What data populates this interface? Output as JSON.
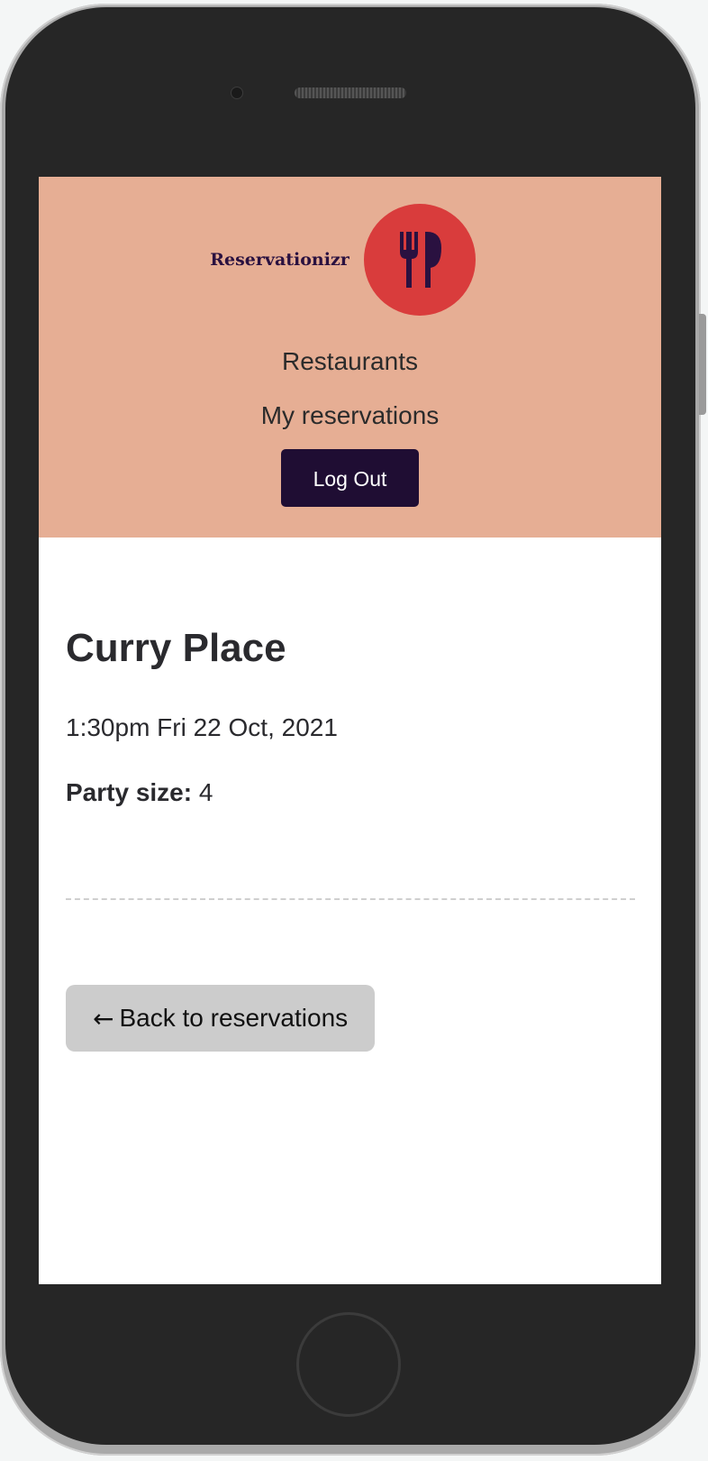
{
  "brand": {
    "name": "Reservationizr",
    "logo_color": "#d93c3c",
    "logo_icon": "fork-knife-icon"
  },
  "nav": {
    "restaurants": "Restaurants",
    "my_reservations": "My reservations",
    "logout": "Log Out"
  },
  "reservation": {
    "restaurant_name": "Curry Place",
    "datetime": "1:30pm Fri 22 Oct, 2021",
    "party_label": "Party size:",
    "party_size": "4"
  },
  "actions": {
    "back_arrow": "←",
    "back_label": "Back to reservations"
  },
  "colors": {
    "header_bg": "#e6ae94",
    "primary_dark": "#1f0d33",
    "back_button_bg": "#cccccc"
  }
}
